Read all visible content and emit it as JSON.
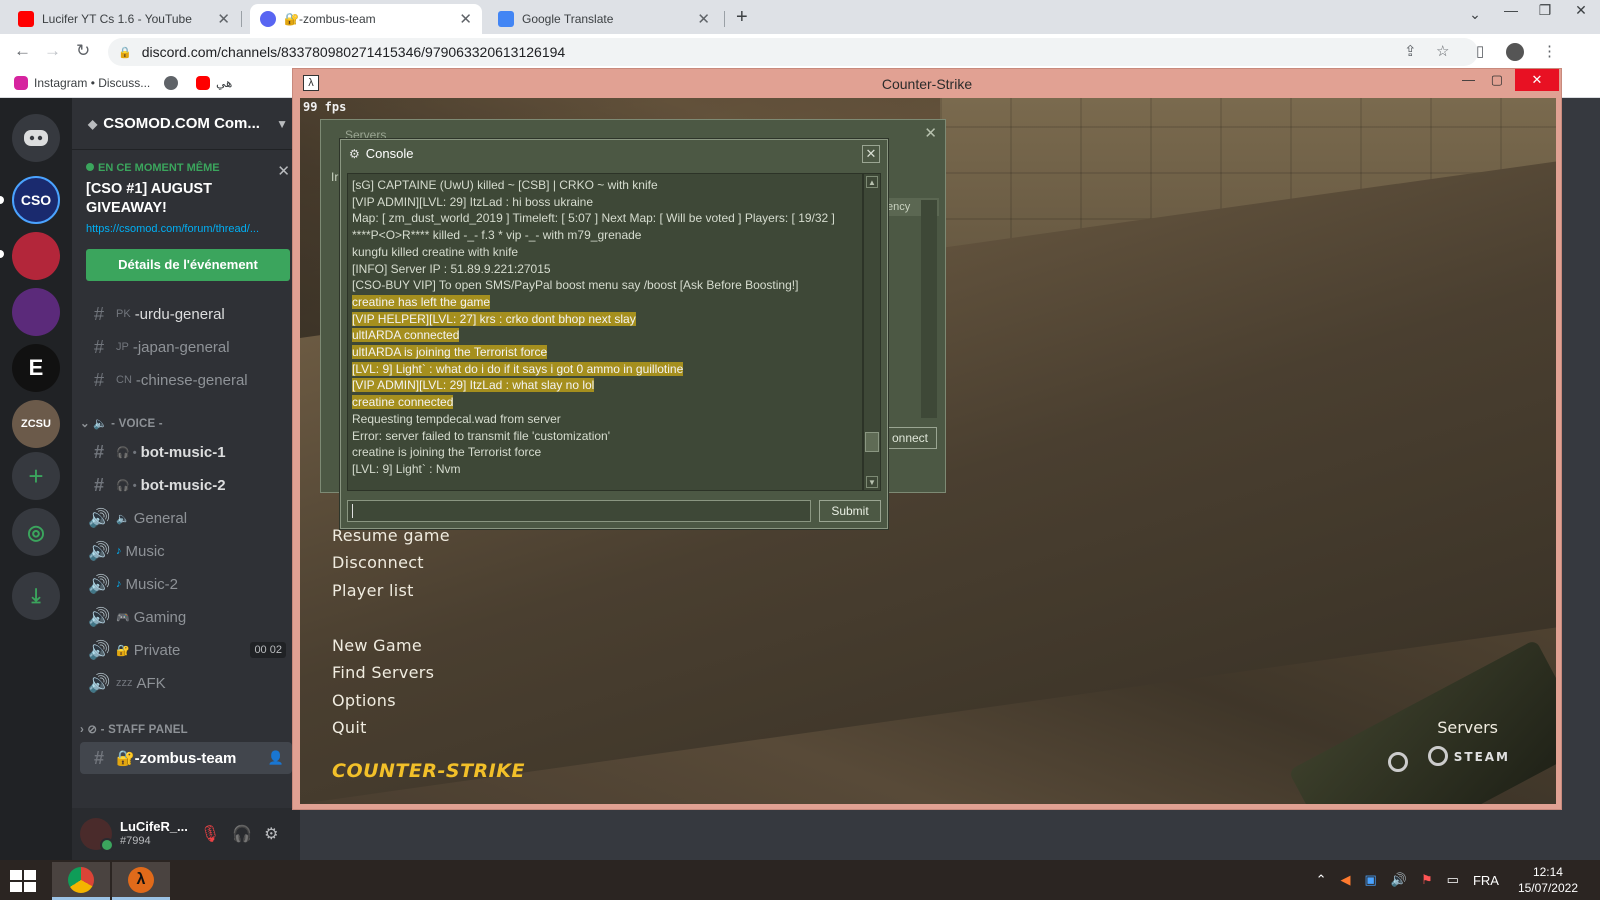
{
  "browser": {
    "tabs": [
      {
        "title": "Lucifer YT Cs 1.6 - YouTube",
        "favicon": "youtube-icon",
        "color": "#ff0000"
      },
      {
        "title": "🔐-zombus-team",
        "favicon": "discord-icon",
        "color": "#5865f2"
      },
      {
        "title": "Google Translate",
        "favicon": "translate-icon",
        "color": "#4285f4"
      }
    ],
    "url": "discord.com/channels/833780980271415346/979063320613126194",
    "bookmarks": [
      {
        "label": "Instagram • Discuss...",
        "icon": "instagram-icon"
      },
      {
        "label": "",
        "icon": "globe-icon"
      },
      {
        "label": "هي",
        "icon": "youtube-icon"
      }
    ]
  },
  "discord": {
    "servers": [
      {
        "name": "CSO",
        "label": "CSO"
      },
      {
        "name": "anime-server",
        "label": ""
      },
      {
        "name": "purple-server",
        "label": ""
      },
      {
        "name": "e-server",
        "label": "E"
      },
      {
        "name": "zcsu-server",
        "label": "ZCSU"
      }
    ],
    "guild_name": "CSOMOD.COM Com...",
    "event": {
      "live_label": "EN CE MOMENT MÊME",
      "title": "[CSO #1] AUGUST GIVEAWAY!",
      "link": "https://csomod.com/forum/thread/...",
      "button": "Détails de l'événement"
    },
    "channels_top": [
      {
        "prefix": "PK",
        "name": "-urdu-general"
      },
      {
        "prefix": "JP",
        "name": "-japan-general"
      },
      {
        "prefix": "CN",
        "name": "-chinese-general"
      }
    ],
    "voice_category": "- VOICE -",
    "voice_channels": [
      {
        "name": "bot-music-1",
        "icon": "#",
        "sub": "🎧 •",
        "bright": true
      },
      {
        "name": "bot-music-2",
        "icon": "#",
        "sub": "🎧 •",
        "bright": true
      },
      {
        "name": "General",
        "icon": "🔊",
        "sub": "🔈",
        "bright": false
      },
      {
        "name": "Music",
        "icon": "🔊",
        "sub": "♪",
        "bright": false
      },
      {
        "name": "Music-2",
        "icon": "🔊",
        "sub": "♪",
        "bright": false
      },
      {
        "name": "Gaming",
        "icon": "🔊",
        "sub": "🎮",
        "bright": false
      },
      {
        "name": "Private",
        "icon": "🔊",
        "sub": "🔐",
        "bright": false,
        "users": [
          "00",
          "02"
        ]
      },
      {
        "name": "AFK",
        "icon": "🔊",
        "sub": "zzz",
        "bright": false
      }
    ],
    "staff_category": "- STAFF PANEL",
    "selected_channel": "🔐-zombus-team",
    "user": {
      "name": "LuCifeR_...",
      "tag": "#7994"
    }
  },
  "cs": {
    "window_title": "Counter-Strike",
    "fps": "99 fps",
    "menu": [
      "Resume game",
      "Disconnect",
      "Player list",
      "New Game",
      "Find Servers",
      "Options",
      "Quit"
    ],
    "logo_text": "COUNTER-STRIKE",
    "servers_label": "Servers",
    "steam_label": "STEAM",
    "servers_dialog": {
      "title": "Servers",
      "tab": "Ir",
      "col_latency": "ency",
      "connect": "onnect"
    },
    "console": {
      "title": "Console",
      "submit": "Submit",
      "lines": [
        {
          "text": "[sG] CAPTAINE (UwU) killed ~ [CSB] | CRKO ~ with knife",
          "hl": false
        },
        {
          "text": "[VIP ADMIN][LVL: 29] ItzLad : hi boss ukraine",
          "hl": false
        },
        {
          "text": "Map: [ zm_dust_world_2019 ] Timeleft: [ 5:07 ] Next Map: [ Will be voted ] Players: [ 19/32 ]",
          "hl": false
        },
        {
          "text": "****P<O>R**** killed -_- f.3 * vip -_- with m79_grenade",
          "hl": false
        },
        {
          "text": "kungfu killed creatine with knife",
          "hl": false
        },
        {
          "text": "[INFO] Server IP : 51.89.9.221:27015",
          "hl": false
        },
        {
          "text": "[CSO-BUY VIP] To open SMS/PayPal boost menu say /boost [Ask Before Boosting!]",
          "hl": false
        },
        {
          "text": "creatine has left the game",
          "hl": true
        },
        {
          "text": "[VIP HELPER][LVL: 27] krs : crko dont bhop next slay",
          "hl": true
        },
        {
          "text": "ultIARDA connected",
          "hl": true
        },
        {
          "text": "ultIARDA is joining the Terrorist force",
          "hl": true
        },
        {
          "text": "[LVL: 9] Light` : what do i do if it says i got 0 ammo in guillotine",
          "hl": true
        },
        {
          "text": "[VIP ADMIN][LVL: 29] ItzLad : what slay no lol",
          "hl": true
        },
        {
          "text": "creatine connected",
          "hl": true
        },
        {
          "text": "Requesting tempdecal.wad from server",
          "hl": false
        },
        {
          "text": "Error: server failed to transmit file 'customization'",
          "hl": false
        },
        {
          "text": "creatine is joining the Terrorist force",
          "hl": false
        },
        {
          "text": "[LVL: 9] Light` : Nvm",
          "hl": false
        }
      ]
    }
  },
  "taskbar": {
    "apps": [
      "chrome-icon",
      "half-life-icon"
    ],
    "lang": "FRA",
    "time": "12:14",
    "date": "15/07/2022"
  },
  "colors": {
    "discord_bg": "#2f3136",
    "discord_rail": "#202225",
    "event_button": "#3ba55d",
    "cs_frame": "#e1a193",
    "console_bg": "#4c5844",
    "console_highlight": "#a58f1e",
    "cs_logo": "#f2c029"
  }
}
